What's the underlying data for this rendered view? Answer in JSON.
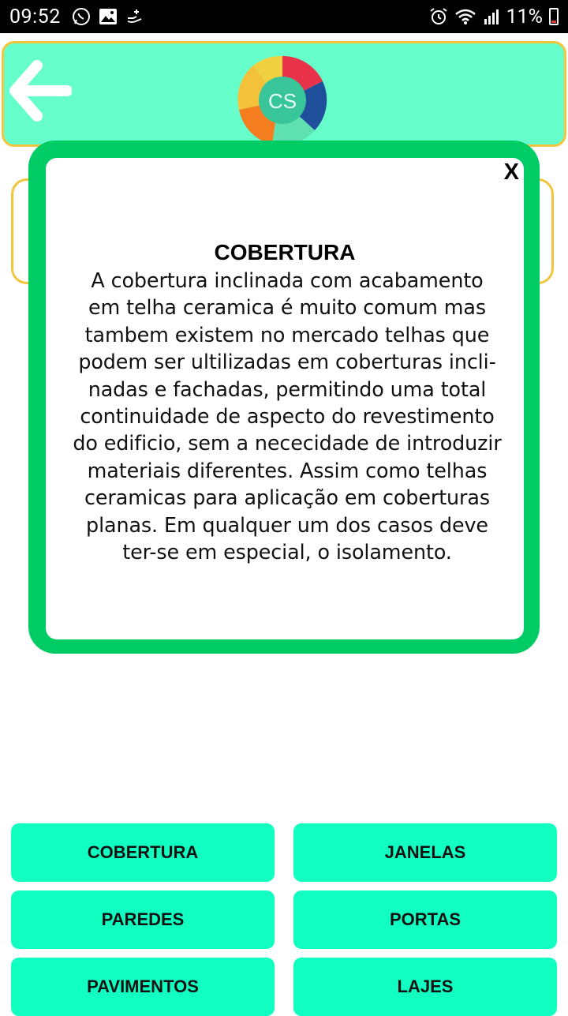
{
  "status_bar": {
    "time": "09:52",
    "battery": "11%",
    "left_icons": [
      "whatsapp-icon",
      "image-icon",
      "hand-icon"
    ],
    "right_icons": [
      "alarm-icon",
      "wifi-icon",
      "signal-icon",
      "battery-icon"
    ]
  },
  "header": {
    "logo_text": "CS",
    "back_icon": "arrow-left-icon",
    "colors": {
      "background": "#66ffcc",
      "border": "#f2c53d"
    }
  },
  "modal": {
    "close_label": "X",
    "title": "COBERTURA",
    "lines": [
      "A cobertura inclinada com acabamento",
      "em telha ceramica é muito comum mas",
      "tambem existem no mercado telhas que",
      "podem ser ultilizadas em coberturas incli-",
      "nadas e fachadas, permitindo uma total",
      "continuidade de aspecto do revestimento",
      "do edificio, sem a nececidade de introduzir",
      "materiais diferentes. Assim como telhas",
      "ceramicas para aplicação em coberturas",
      "planas. Em qualquer um dos casos deve",
      "ter-se em especial, o isolamento."
    ],
    "colors": {
      "frame": "#00cc66"
    }
  },
  "buttons": {
    "cobertura": "COBERTURA",
    "janelas": "JANELAS",
    "paredes": "PAREDES",
    "portas": "PORTAS",
    "pavimentos": "PAVIMENTOS",
    "lajes": "LAJES",
    "color": "#11ffc0"
  }
}
